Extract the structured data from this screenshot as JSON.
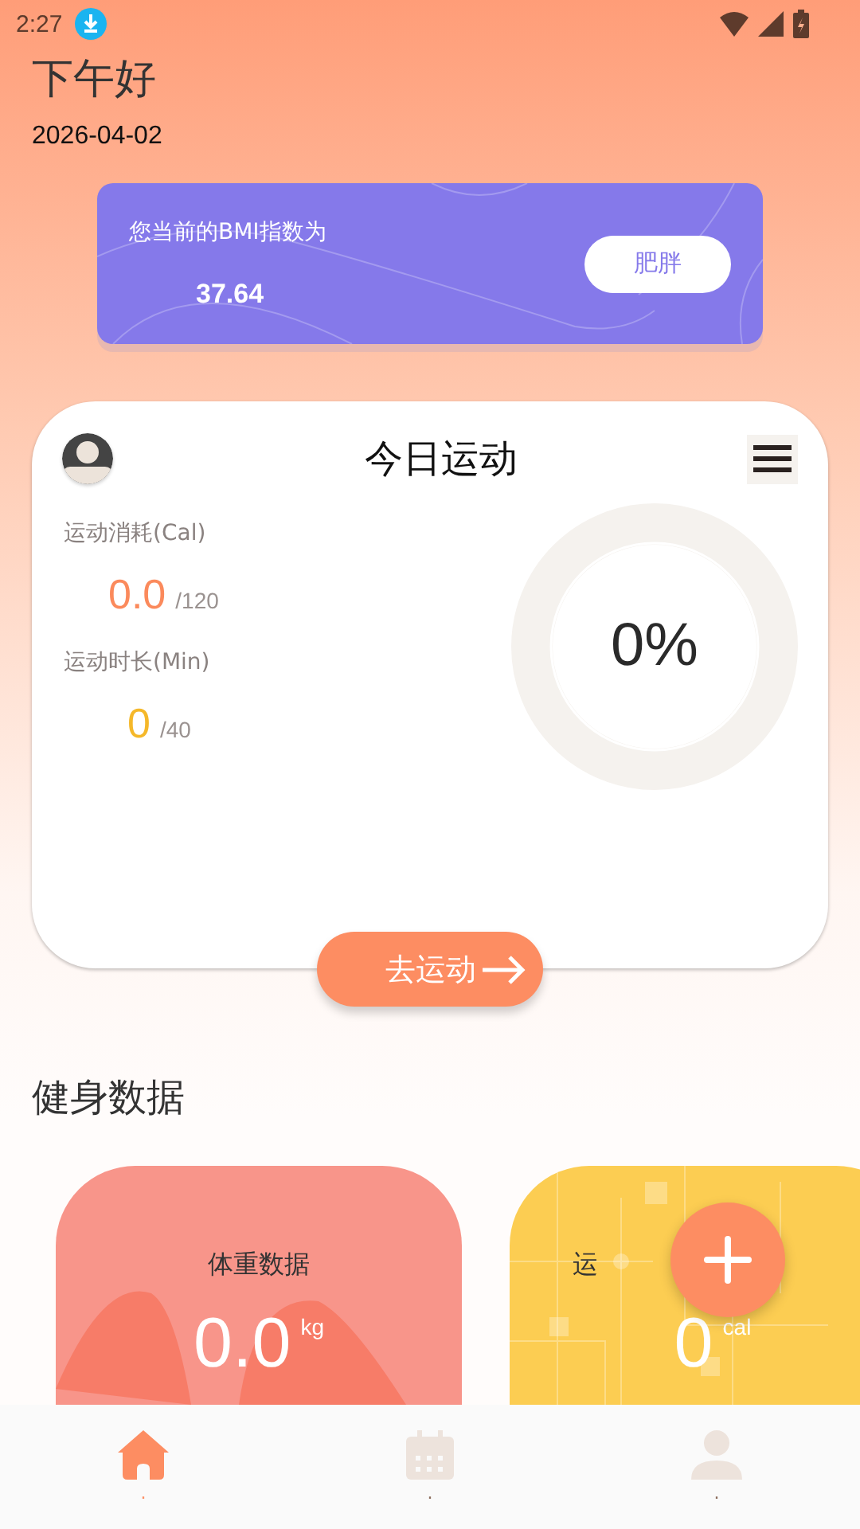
{
  "status_bar": {
    "time": "2:27"
  },
  "greeting": "下午好",
  "date": "2026-04-02",
  "bmi": {
    "label": "您当前的BMI指数为",
    "value": "37.64",
    "category": "肥胖"
  },
  "today": {
    "title": "今日运动",
    "stats": [
      {
        "label": "运动消耗(Cal)",
        "value": "0.0",
        "target": "/120",
        "color": "#fb8a5c"
      },
      {
        "label": "运动时长(Min)",
        "value": "0",
        "target": "/40",
        "color": "#f5b82a"
      }
    ],
    "progress": {
      "level": 0,
      "reading": "0%"
    },
    "action": "去运动"
  },
  "section_title": "健身数据",
  "data_cards": [
    {
      "kind": "weight",
      "title": "体重数据",
      "value": "0.0",
      "unit": "kg"
    },
    {
      "kind": "exercise",
      "title": "运",
      "value": "0",
      "unit": "cal"
    }
  ],
  "nav": [
    {
      "kind": "home",
      "label": ".",
      "selected": true
    },
    {
      "kind": "calendar",
      "label": ".",
      "selected": false
    },
    {
      "kind": "person",
      "label": ".",
      "selected": false
    }
  ]
}
